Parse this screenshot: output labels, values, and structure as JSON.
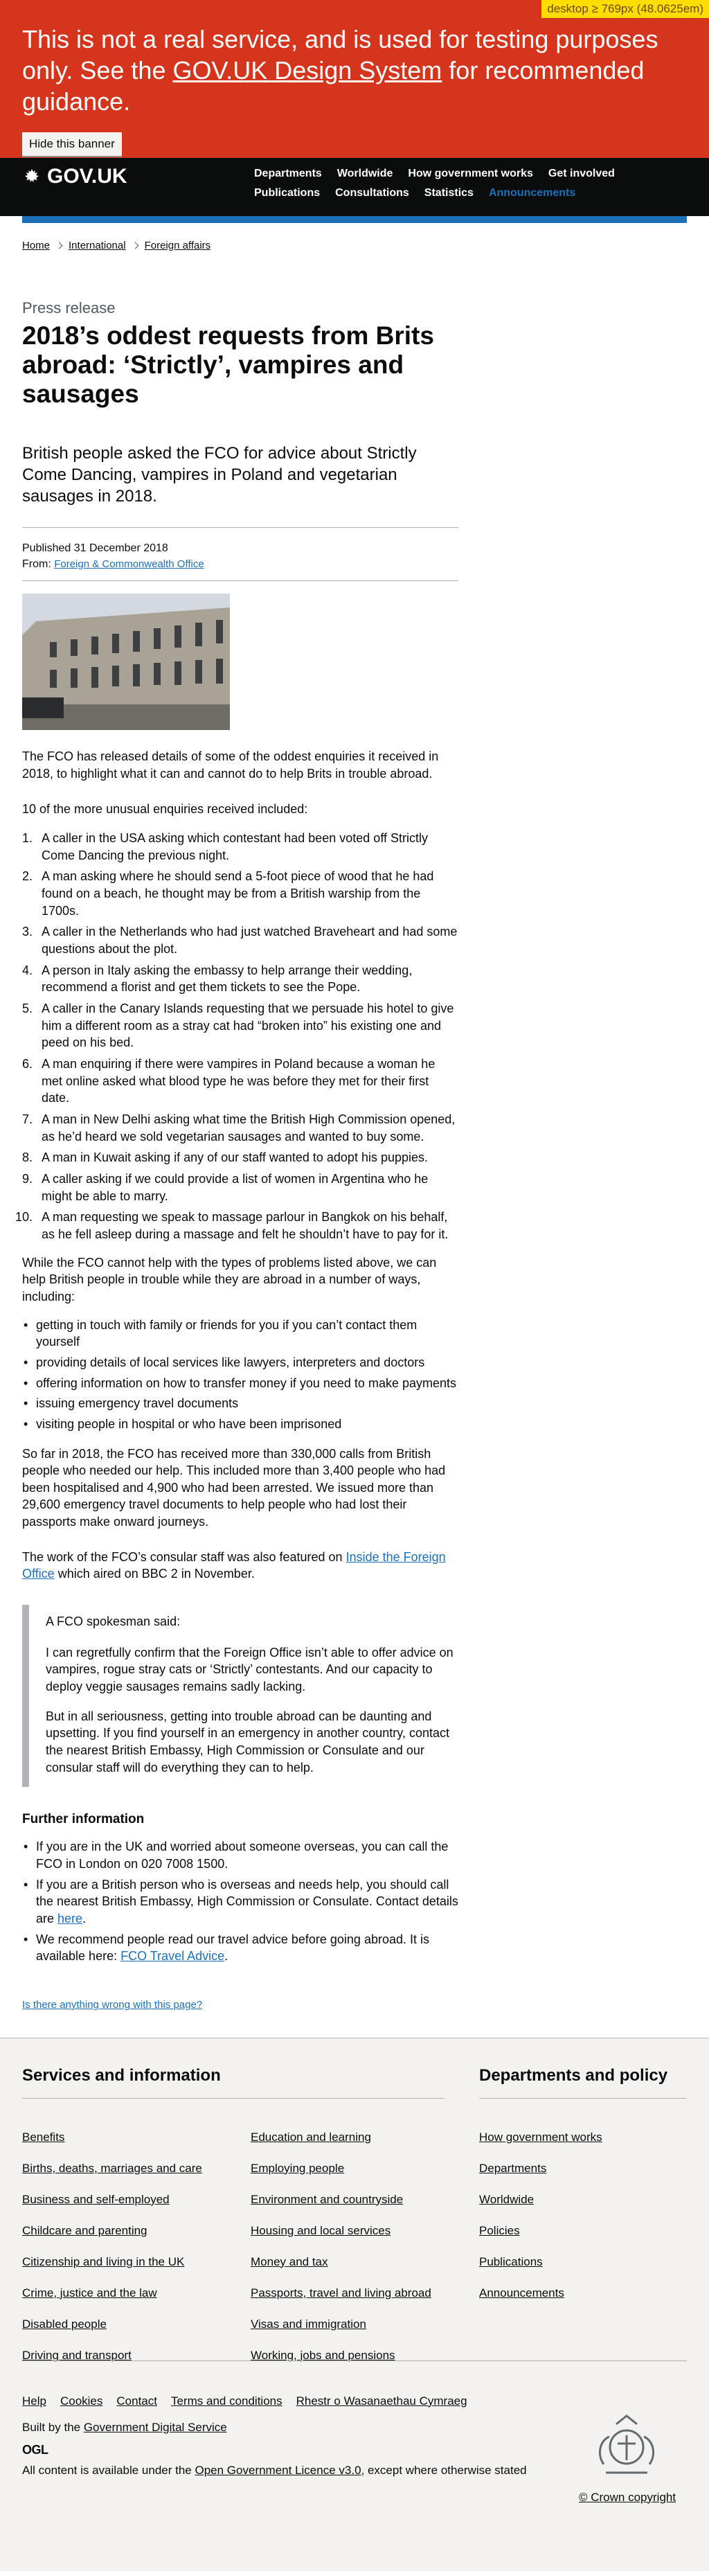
{
  "debug": {
    "badge": "desktop ≥ 769px (48.0625em)"
  },
  "banner": {
    "message_before": "This is not a real service, and is used for testing purposes only. See the ",
    "message_link": "GOV.UK Design System",
    "message_after": " for recommended guidance.",
    "hide_button": "Hide this banner"
  },
  "header": {
    "logo": "GOV.UK",
    "nav": [
      "Departments",
      "Worldwide",
      "How government works",
      "Get involved",
      "Publications",
      "Consultations",
      "Statistics",
      "Announcements"
    ],
    "active_nav": "Announcements"
  },
  "breadcrumb": [
    "Home",
    "International",
    "Foreign affairs"
  ],
  "article": {
    "caption": "Press release",
    "title": "2018’s oddest requests from Brits abroad: ‘Strictly’, vampires and sausages",
    "lede": "British people asked the FCO for advice about Strictly Come Dancing, vampires in Poland and vegetarian sausages in 2018.",
    "published": "Published 31 December 2018",
    "from_label": "From: ",
    "from_link": "Foreign & Commonwealth Office",
    "intro": "The FCO has released details of some of the oddest enquiries it received in 2018, to highlight what it can and cannot do to help Brits in trouble abroad.",
    "list_intro": "10 of the more unusual enquiries received included:",
    "enquiries": [
      "A caller in the USA asking which contestant had been voted off Strictly Come Dancing the previous night.",
      "A man asking where he should send a 5-foot piece of wood that he had found on a beach, he thought may be from a British warship from the 1700s.",
      "A caller in the Netherlands who had just watched Braveheart and had some questions about the plot.",
      "A person in Italy asking the embassy to help arrange their wedding, recommend a florist and get them tickets to see the Pope.",
      "A caller in the Canary Islands requesting that we persuade his hotel to give him a different room as a stray cat had “broken into” his existing one and peed on his bed.",
      "A man enquiring if there were vampires in Poland because a woman he met online asked what blood type he was before they met for their first date.",
      "A man in New Delhi asking what time the British High Commission opened, as he’d heard we sold vegetarian sausages and wanted to buy some.",
      "A man in Kuwait asking if any of our staff wanted to adopt his puppies.",
      "A caller asking if we could provide a list of women in Argentina who he might be able to marry.",
      "A man requesting we speak to massage parlour in Bangkok on his behalf, as he fell asleep during a massage and felt he shouldn’t have to pay for it."
    ],
    "help_intro": "While the FCO cannot help with the types of problems listed above, we can help British people in trouble while they are abroad in a number of ways, including:",
    "help_items": [
      "getting in touch with family or friends for you if you can’t contact them yourself",
      "providing details of local services like lawyers, interpreters and doctors",
      "offering information on how to transfer money if you need to make payments",
      "issuing emergency travel documents",
      "visiting people in hospital or who have been imprisoned"
    ],
    "stats": "So far in 2018, the FCO has received more than 330,000 calls from British people who needed our help. This included more than 3,400 people who had been hospitalised and 4,900 who had been arrested. We issued more than 29,600 emergency travel documents to help people who had lost their passports make onward journeys.",
    "featured_before": "The work of the FCO’s consular staff was also featured on ",
    "featured_link": "Inside the Foreign Office",
    "featured_after": " which aired on BBC 2 in November.",
    "quote_said": "A FCO spokesman said:",
    "quote_1": "I can regretfully confirm that the Foreign Office isn’t able to offer advice on vampires, rogue stray cats or ‘Strictly’ contestants. And our capacity to deploy veggie sausages remains sadly lacking.",
    "quote_2": "But in all seriousness, getting into trouble abroad can be daunting and upsetting. If you find yourself in an emergency in another country, contact the nearest British Embassy, High Commission or Consulate and our consular staff will do everything they can to help.",
    "further_heading": "Further information",
    "further_1": "If you are in the UK and worried about someone overseas, you can call the FCO in London on 020 7008 1500.",
    "further_2_before": "If you are a British person who is overseas and needs help, you should call the nearest British Embassy, High Commission or Consulate. Contact details are ",
    "further_2_link": "here",
    "further_2_after": ".",
    "further_3_before": "We recommend people read our travel advice before going abroad. It is available here: ",
    "further_3_link": "FCO Travel Advice",
    "further_3_after": ".",
    "report_link": "Is there anything wrong with this page?"
  },
  "footer": {
    "services_heading": "Services and information",
    "services_col1": [
      "Benefits",
      "Births, deaths, marriages and care",
      "Business and self-employed",
      "Childcare and parenting",
      "Citizenship and living in the UK",
      "Crime, justice and the law",
      "Disabled people",
      "Driving and transport"
    ],
    "services_col2": [
      "Education and learning",
      "Employing people",
      "Environment and countryside",
      "Housing and local services",
      "Money and tax",
      "Passports, travel and living abroad",
      "Visas and immigration",
      "Working, jobs and pensions"
    ],
    "departments_heading": "Departments and policy",
    "departments": [
      "How government works",
      "Departments",
      "Worldwide",
      "Policies",
      "Publications",
      "Announcements"
    ],
    "meta_links": [
      "Help",
      "Cookies",
      "Contact",
      "Terms and conditions",
      "Rhestr o Wasanaethau Cymraeg"
    ],
    "built_before": "Built by the ",
    "built_link": "Government Digital Service",
    "ogl": "OGL",
    "licence_before": "All content is available under the ",
    "licence_link": "Open Government Licence v3.0",
    "licence_after": ", except where otherwise stated",
    "copyright": "© Crown copyright"
  },
  "colors": {
    "banner": "#d4351c",
    "header": "#0b0c0c",
    "link": "#1d70b8",
    "footer": "#f3f2f1"
  }
}
